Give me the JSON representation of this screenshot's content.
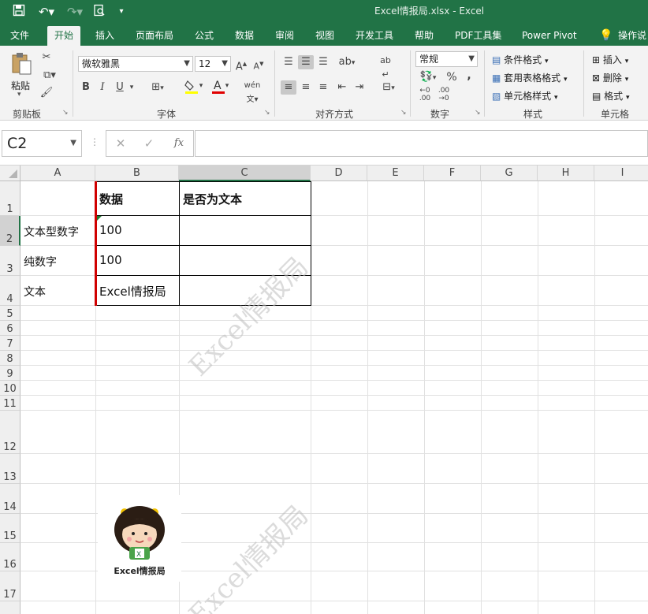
{
  "window": {
    "title": "Excel情报局.xlsx  -  Excel"
  },
  "ribbon_tabs": [
    "文件",
    "开始",
    "插入",
    "页面布局",
    "公式",
    "数据",
    "审阅",
    "视图",
    "开发工具",
    "帮助",
    "PDF工具集",
    "Power Pivot"
  ],
  "tell_me": "操作说",
  "clipboard": {
    "paste": "粘贴",
    "label": "剪贴板"
  },
  "font": {
    "name": "微软雅黑",
    "size": "12",
    "label": "字体",
    "bold": "B",
    "italic": "I",
    "underline": "U"
  },
  "alignment": {
    "label": "对齐方式"
  },
  "number": {
    "format": "常规",
    "label": "数字",
    "percent": "%",
    "comma": ","
  },
  "styles": {
    "conditional": "条件格式",
    "table": "套用表格格式",
    "cell_styles": "单元格样式",
    "label": "样式"
  },
  "cells": {
    "insert": "插入",
    "delete": "删除",
    "format": "格式",
    "label": "单元格"
  },
  "formula_bar": {
    "name_box": "C2",
    "fx": "fx",
    "content": ""
  },
  "columns": [
    "A",
    "B",
    "C",
    "D",
    "E",
    "F",
    "G",
    "H",
    "I"
  ],
  "rows": [
    "1",
    "2",
    "3",
    "4",
    "5",
    "6",
    "7",
    "8",
    "9",
    "10",
    "11",
    "12",
    "13",
    "14",
    "15",
    "16",
    "17"
  ],
  "sheet": {
    "b1": "数据",
    "c1": "是否为文本",
    "a2": "文本型数字",
    "b2": "100",
    "a3": "纯数字",
    "b3": "100",
    "a4": "文本",
    "b4": "Excel情报局"
  },
  "watermark": "Excel情报局",
  "logo_caption": "Excel情报局",
  "colors": {
    "excel_green": "#217346",
    "accent_red": "#d00000"
  }
}
